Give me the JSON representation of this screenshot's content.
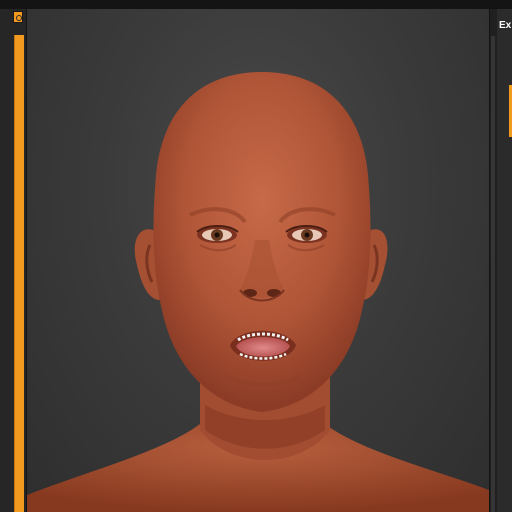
{
  "right_panel": {
    "title": "Ex"
  },
  "colors": {
    "accent": "#f29a1f",
    "skin": "#b85a3c",
    "viewport_background": "#3b3b3b"
  },
  "icons": {
    "timeline_handle": "slider-handle-icon"
  }
}
